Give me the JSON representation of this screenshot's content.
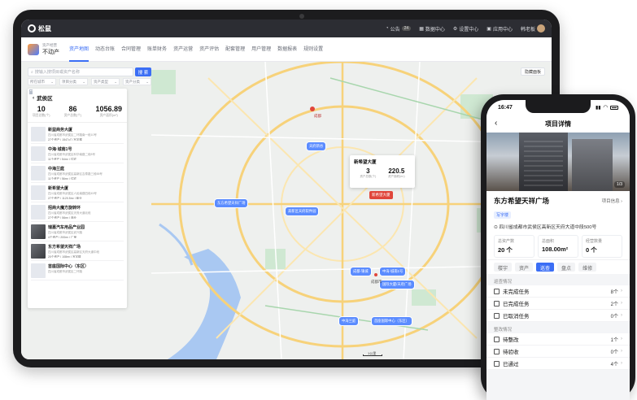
{
  "tablet": {
    "brand": "松鼠",
    "topbar": {
      "notice": "公告",
      "notice_count": "24",
      "data_center": "数据中心",
      "settings_center": "设置中心",
      "app_center": "应用中心",
      "user": "韩老板"
    },
    "app": {
      "subtitle": "资产经营",
      "title": "不动产"
    },
    "menu": [
      "资产地图",
      "动态台账",
      "合同管理",
      "账单财务",
      "资产运营",
      "资产评估",
      "配套管理",
      "用户管理",
      "数据报表",
      "规则设置"
    ],
    "search": {
      "placeholder": "搜输入搜项目或资产名称",
      "button": "搜 索"
    },
    "filters": [
      "所在城市",
      "项目分类",
      "资产类型",
      "资产分类"
    ],
    "hide_panel": "隐藏面板",
    "panel": {
      "region": "武侯区",
      "stats": [
        {
          "value": "10",
          "label": "项目总数(个)"
        },
        {
          "value": "86",
          "label": "资产总数(个)"
        },
        {
          "value": "1056.89",
          "label": "资产面积(m²)"
        }
      ],
      "projects": [
        {
          "name": "新益商务大厦",
          "addr": "四川省成都市武侯区二环路南一段10号",
          "tags": "27个资产 | 1547㎡ | 写字楼",
          "thumb": "icon"
        },
        {
          "name": "中海·城南1号",
          "addr": "四川省成都市武侯区科华南路二段8号",
          "tags": "11个资产 | 54m² | 住宅",
          "thumb": "icon"
        },
        {
          "name": "中海兰庭",
          "addr": "四川省成都市武侯区高新区吉泰路三段88号",
          "tags": "11个资产 | 56m² | 住宅",
          "thumb": "icon"
        },
        {
          "name": "新希望大厦",
          "addr": "四川省成都市武侯区人民南路四段45号",
          "tags": "27个资产 | 1120.5m² | 商业",
          "thumb": "icon"
        },
        {
          "name": "招商大魔方旋转环",
          "addr": "四川省成都市武侯区天府大道北段",
          "tags": "27个资产 | 56m² | 商业",
          "thumb": "icon"
        },
        {
          "name": "瑞嘉汽车用品产业园",
          "addr": "四川省成都市武侯区武兴路",
          "tags": "4个资产 | 200m² | 厂房",
          "thumb": "photo"
        },
        {
          "name": "东方希望天祥广场",
          "addr": "四川省成都市武侯区高新区天府大道中段",
          "tags": "20个资产 | 108m² | 写字楼",
          "thumb": "photo"
        },
        {
          "name": "首座国际中心（东区）",
          "addr": "四川省成都市武侯区二环路",
          "tags": "",
          "thumb": "icon"
        }
      ]
    },
    "popup": {
      "title": "新希望大厦",
      "left_value": "3",
      "left_label": "资产总数(个)",
      "right_value": "220.5",
      "right_label": "资产面积(m²)",
      "tag": "新希望大厦"
    },
    "chips": [
      "天府新谷",
      "东方希望天祥广场",
      "高新区天府软件园",
      "中海·城南1号",
      "成都·锦城",
      "国际大厦/天府广场",
      "中海兰庭",
      "首座国际中心（东区）"
    ],
    "map_labels": [
      "成都",
      "成都市"
    ],
    "scale": "1公里"
  },
  "phone": {
    "time": "16:47",
    "header": "项目详情",
    "photo_count": "1/3",
    "project_name": "东方希望天祥广场",
    "info_link": "项目信息 ›",
    "tag": "写字楼",
    "address": "四川省成都市武侯区高新区天府大道中段500号",
    "kv": [
      {
        "label": "总资产数",
        "value": "20 个"
      },
      {
        "label": "总面积",
        "value": "108.00m²"
      },
      {
        "label": "经营数量",
        "value": "0 个"
      }
    ],
    "tabs": [
      "楼宇",
      "资产",
      "巡查",
      "盘点",
      "维修"
    ],
    "section1": "巡查情况",
    "tasks1": [
      {
        "name": "未完成任务",
        "count": "8个"
      },
      {
        "name": "已完成任务",
        "count": "2个"
      },
      {
        "name": "已取消任务",
        "count": "0个"
      }
    ],
    "section2": "整改情况",
    "tasks2": [
      {
        "name": "待整改",
        "count": "1个"
      },
      {
        "name": "待验收",
        "count": "0个"
      },
      {
        "name": "已通过",
        "count": "4个"
      }
    ]
  }
}
